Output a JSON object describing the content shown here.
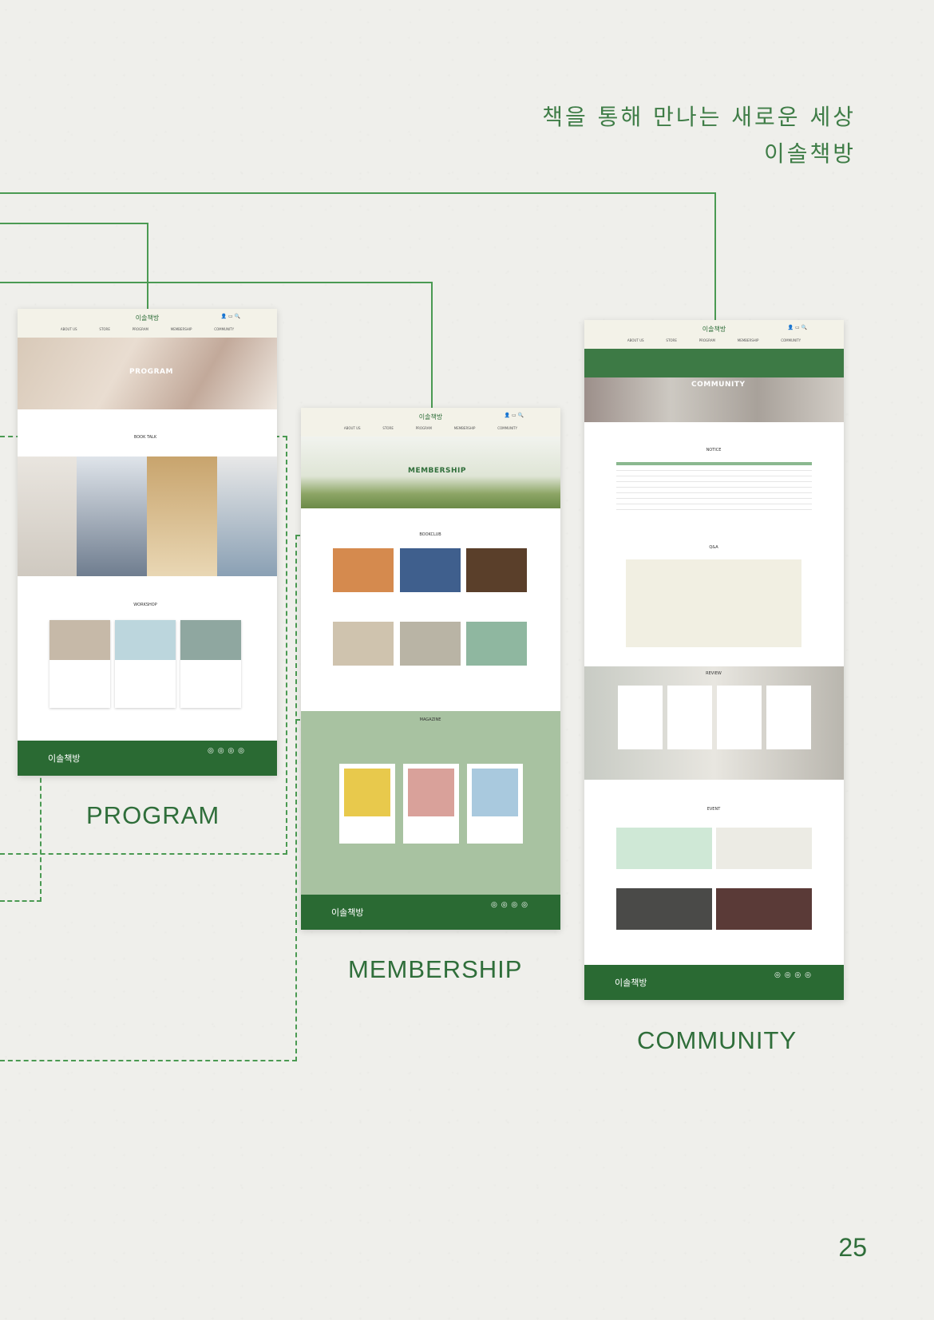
{
  "tagline": {
    "line1": "책을 통해 만나는 새로운 세상",
    "line2": "이솔책방"
  },
  "page_number": "25",
  "site": {
    "logo": "이솔책방",
    "nav": [
      "ABOUT US",
      "STORE",
      "PROGRAM",
      "MEMBERSHIP",
      "COMMUNITY"
    ],
    "sns_icons": "◎ ◎ ◎ ◎"
  },
  "program": {
    "caption": "PROGRAM",
    "hero_title": "PROGRAM",
    "book_talk": "BOOK TALK",
    "workshop": "WORKSHOP"
  },
  "membership": {
    "caption": "MEMBERSHIP",
    "hero_title": "MEMBERSHIP",
    "bookclub": "BOOKCLUB",
    "magazine": "MAGAZINE"
  },
  "community": {
    "caption": "COMMUNITY",
    "hero_title": "COMMUNITY",
    "notice": "NOTICE",
    "qna": "Q&A",
    "review": "REVIEW",
    "event": "EVENT"
  },
  "colors": {
    "brand_green": "#2a6a33",
    "accent_green": "#4a9a52",
    "background": "#efefeb"
  }
}
